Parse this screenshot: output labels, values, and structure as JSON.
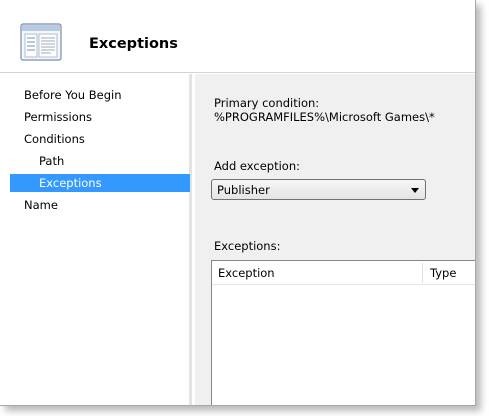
{
  "header": {
    "title": "Exceptions",
    "icon": "wizard-page-icon"
  },
  "nav": {
    "items": [
      {
        "label": "Before You Begin"
      },
      {
        "label": "Permissions"
      },
      {
        "label": "Conditions"
      },
      {
        "label": "Path"
      },
      {
        "label": "Exceptions"
      },
      {
        "label": "Name"
      }
    ],
    "selected": "Exceptions"
  },
  "content": {
    "primary_condition_label": "Primary condition:",
    "primary_condition_value": "%PROGRAMFILES%\\Microsoft Games\\*",
    "add_exception_label": "Add exception:",
    "add_exception_value": "Publisher",
    "exceptions_label": "Exceptions:",
    "columns": [
      "Exception",
      "Type"
    ]
  },
  "colors": {
    "selected_background": "#3399ff",
    "content_background": "#f0f0f0"
  }
}
